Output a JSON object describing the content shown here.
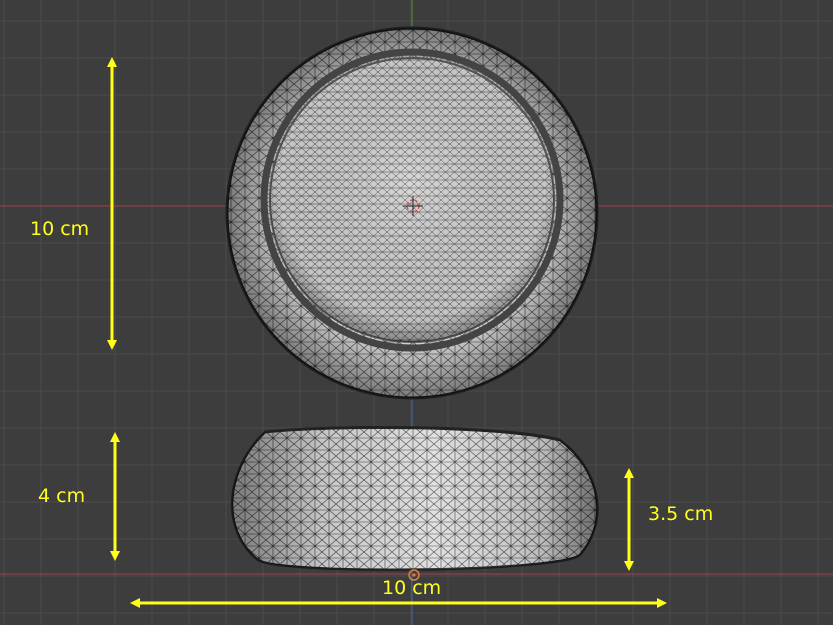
{
  "viewport": {
    "background_color": "#3d3d3d",
    "grid_color": "#4a4a4a",
    "x_axis_color": "#a0444f",
    "y_axis_color": "#5a8a2a",
    "z_axis_color": "#3a6aa0"
  },
  "dimensions": {
    "color": "#ffff1a",
    "top_view_height": "10 cm",
    "side_view_height": "4 cm",
    "side_view_inner_height": "3.5 cm",
    "side_view_width": "10 cm"
  },
  "mesh": {
    "fill_color": "#d9d9d9",
    "wire_color": "#2a2a2a"
  }
}
